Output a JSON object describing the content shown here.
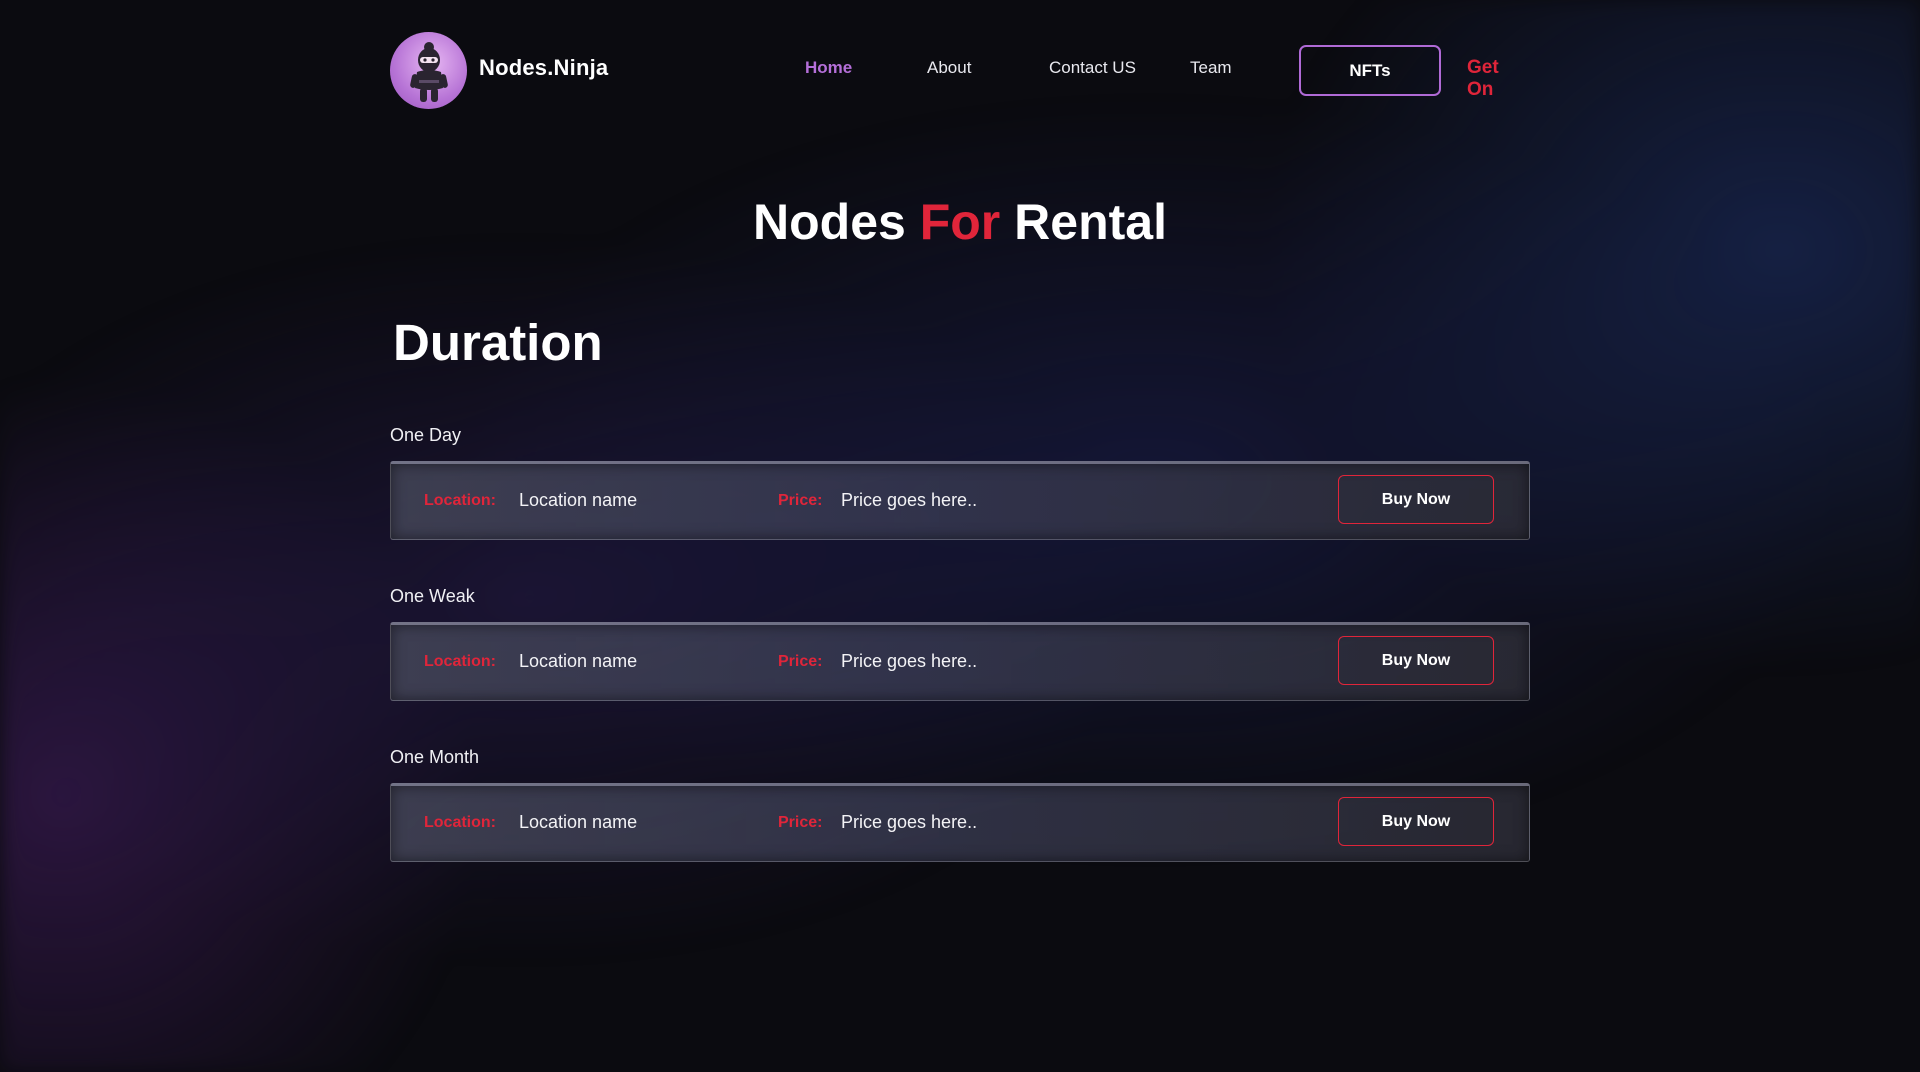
{
  "colors": {
    "accent_red": "#e0253a",
    "accent_purple": "#b56fd9",
    "background": "#0b0b10"
  },
  "brand": {
    "name": "Nodes.Ninja",
    "logo_icon": "ninja-icon"
  },
  "nav": {
    "items": [
      {
        "label": "Home",
        "active": true
      },
      {
        "label": "About",
        "active": false
      },
      {
        "label": "Contact US",
        "active": false
      },
      {
        "label": "Team",
        "active": false
      }
    ],
    "nfts_label": "NFTs",
    "get_on_label": "Get On"
  },
  "hero": {
    "title_part1": "Nodes",
    "title_accent": "For",
    "title_part2": "Rental"
  },
  "section": {
    "title": "Duration"
  },
  "plans": [
    {
      "duration": "One Day",
      "location_label": "Location:",
      "location_value": "Location name",
      "price_label": "Price:",
      "price_value": "Price goes here..",
      "button_label": "Buy Now"
    },
    {
      "duration": "One Weak",
      "location_label": "Location:",
      "location_value": "Location name",
      "price_label": "Price:",
      "price_value": "Price goes here..",
      "button_label": "Buy Now"
    },
    {
      "duration": "One Month",
      "location_label": "Location:",
      "location_value": "Location name",
      "price_label": "Price:",
      "price_value": "Price goes here..",
      "button_label": "Buy Now"
    }
  ]
}
